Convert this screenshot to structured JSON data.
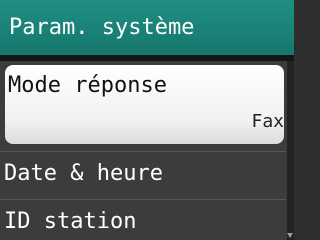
{
  "header": {
    "title": "Param. système"
  },
  "menu": {
    "items": [
      {
        "label": "Mode réponse",
        "value": "Fax"
      },
      {
        "label": "Date & heure"
      },
      {
        "label": "ID station"
      }
    ]
  },
  "colors": {
    "title_bar": "#1a847a",
    "background": "#3c3c3c",
    "selected_item": "#ffffff"
  },
  "icons": {
    "scroll": "scroll-down-arrow-icon"
  }
}
